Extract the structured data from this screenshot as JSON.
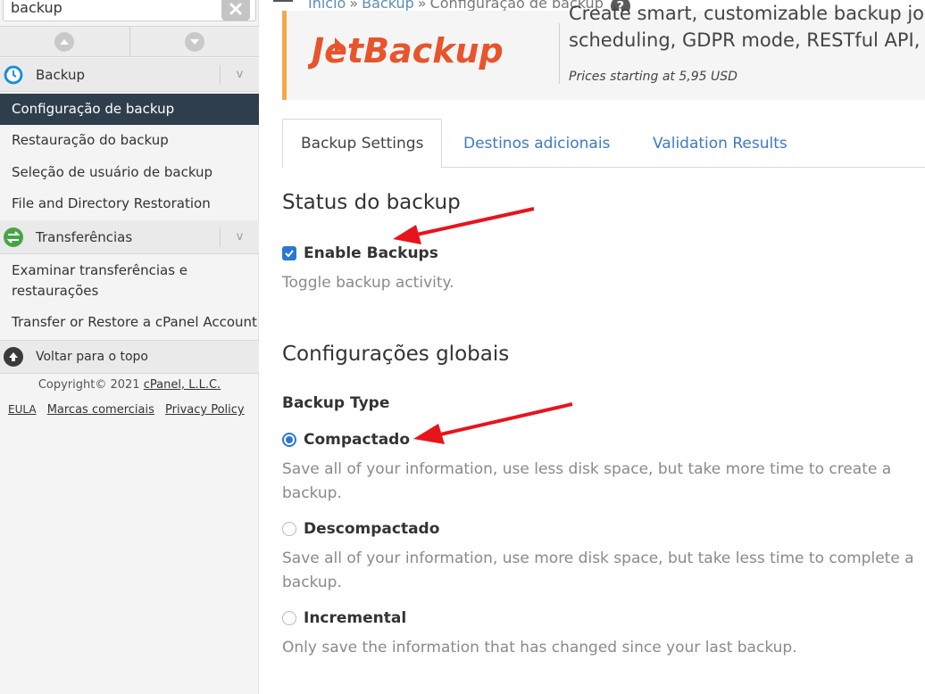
{
  "sidebar": {
    "search": {
      "value": "backup",
      "placeholder": ""
    },
    "categories": [
      {
        "label": "Backup",
        "icon": "backup-icon"
      },
      {
        "label": "Transferências",
        "icon": "transfer-icon"
      }
    ],
    "backup_items": [
      {
        "label": "Configuração de backup",
        "active": true
      },
      {
        "label": "Restauração do backup"
      },
      {
        "label": "Seleção de usuário de backup"
      },
      {
        "label": "File and Directory Restoration"
      }
    ],
    "transfer_items": [
      {
        "label": "Examinar transferências e restaurações"
      },
      {
        "label": "Transfer or Restore a cPanel Account"
      }
    ],
    "back_to_top": "Voltar para o topo",
    "copyright_prefix": "Copyright© 2021",
    "copyright_link": "cPanel, L.L.C.",
    "legal_links": [
      "EULA",
      "Marcas comerciais",
      "Privacy Policy"
    ]
  },
  "breadcrumb": [
    "Início",
    "Backup",
    "Configuração de backup"
  ],
  "banner": {
    "logo_text": "JetBackup",
    "line1": "Create smart, customizable backup jobs",
    "line2": "scheduling, GDPR mode, RESTful API, and",
    "price": "Prices starting at 5,95 USD",
    "accent": "#f4a84a"
  },
  "tabs": [
    "Backup Settings",
    "Destinos adicionais",
    "Validation Results"
  ],
  "status_section": {
    "title": "Status do backup",
    "checkbox_label": "Enable Backups",
    "checkbox_checked": true,
    "help": "Toggle backup activity."
  },
  "global_section": {
    "title": "Configurações globais",
    "backup_type_label": "Backup Type",
    "options": [
      {
        "label": "Compactado",
        "selected": true,
        "help": "Save all of your information, use less disk space, but take more time to create a backup."
      },
      {
        "label": "Descompactado",
        "selected": false,
        "help": "Save all of your information, use more disk space, but take less time to complete a backup."
      },
      {
        "label": "Incremental",
        "selected": false,
        "help": "Only save the information that has changed since your last backup."
      }
    ]
  },
  "colors": {
    "accent_blue": "#2b78d3",
    "link_blue": "#3d7ac7",
    "sidebar_active": "#2f3e4d",
    "annotation_arrow": "#e8141b"
  }
}
